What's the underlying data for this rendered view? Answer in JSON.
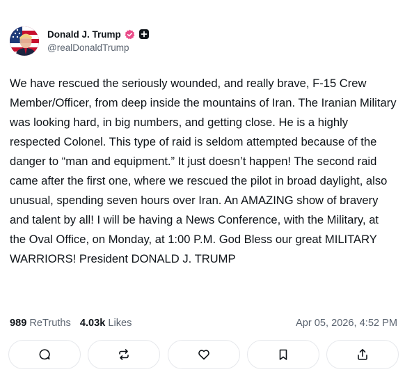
{
  "post": {
    "author": {
      "display_name": "Donald J. Trump",
      "handle": "@realDonaldTrump",
      "avatar_icon": "avatar-portrait-flag",
      "verified_icon": "verified-badge-icon",
      "verified_color": "#ea4c89",
      "badge_icon": "plus-badge-icon"
    },
    "text": "We have rescued the seriously wounded, and really brave, F-15 Crew Member/Officer, from deep inside the mountains of Iran. The Iranian Military was looking hard, in big numbers, and getting close. He is a highly respected Colonel. This type of raid is seldom attempted because of the danger to “man and equipment.” It just doesn’t happen! The second raid came after the first one, where we rescued the pilot in broad daylight, also unusual, spending seven hours over Iran. An AMAZING show of bravery and talent by all! I will be having a News Conference, with the Military, at the Oval Office, on Monday, at 1:00 P.M. God Bless our great MILITARY WARRIORS! President DONALD J. TRUMP",
    "stats": {
      "retruths_count": "989",
      "retruths_label": "ReTruths",
      "likes_count": "4.03k",
      "likes_label": "Likes"
    },
    "timestamp": "Apr 05, 2026, 4:52 PM",
    "actions": [
      {
        "icon": "reply-icon"
      },
      {
        "icon": "retruth-icon"
      },
      {
        "icon": "like-icon"
      },
      {
        "icon": "bookmark-icon"
      },
      {
        "icon": "share-icon"
      }
    ],
    "colors": {
      "text": "#0f1419",
      "muted": "#5b6470",
      "border": "#e6e8ec"
    }
  }
}
